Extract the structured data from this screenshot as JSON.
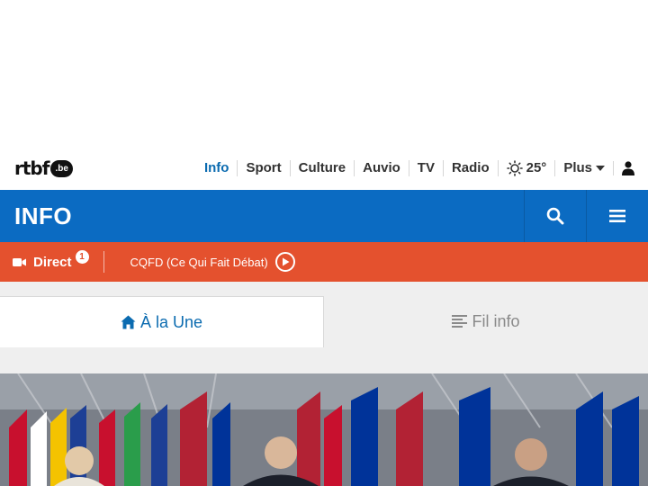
{
  "brand": {
    "logo_text": "rtbf",
    "logo_badge": ".be"
  },
  "topnav": {
    "items": [
      "Info",
      "Sport",
      "Culture",
      "Auvio",
      "TV",
      "Radio"
    ],
    "weather_temp": "25°",
    "more_label": "Plus"
  },
  "section": {
    "title": "INFO"
  },
  "live_bar": {
    "direct_label": "Direct",
    "direct_count": "1",
    "program_label": "CQFD (Ce Qui Fait Débat)"
  },
  "tabs": {
    "active_label": "À la Une",
    "inactive_label": "Fil info"
  },
  "colors": {
    "brand_blue": "#0b6bc2",
    "live_red": "#e4512e",
    "active_link": "#0b6bb0"
  },
  "icons": [
    "sun-icon",
    "chevron-down-icon",
    "user-icon",
    "search-icon",
    "menu-icon",
    "video-camera-icon",
    "play-icon",
    "home-icon",
    "list-icon"
  ]
}
